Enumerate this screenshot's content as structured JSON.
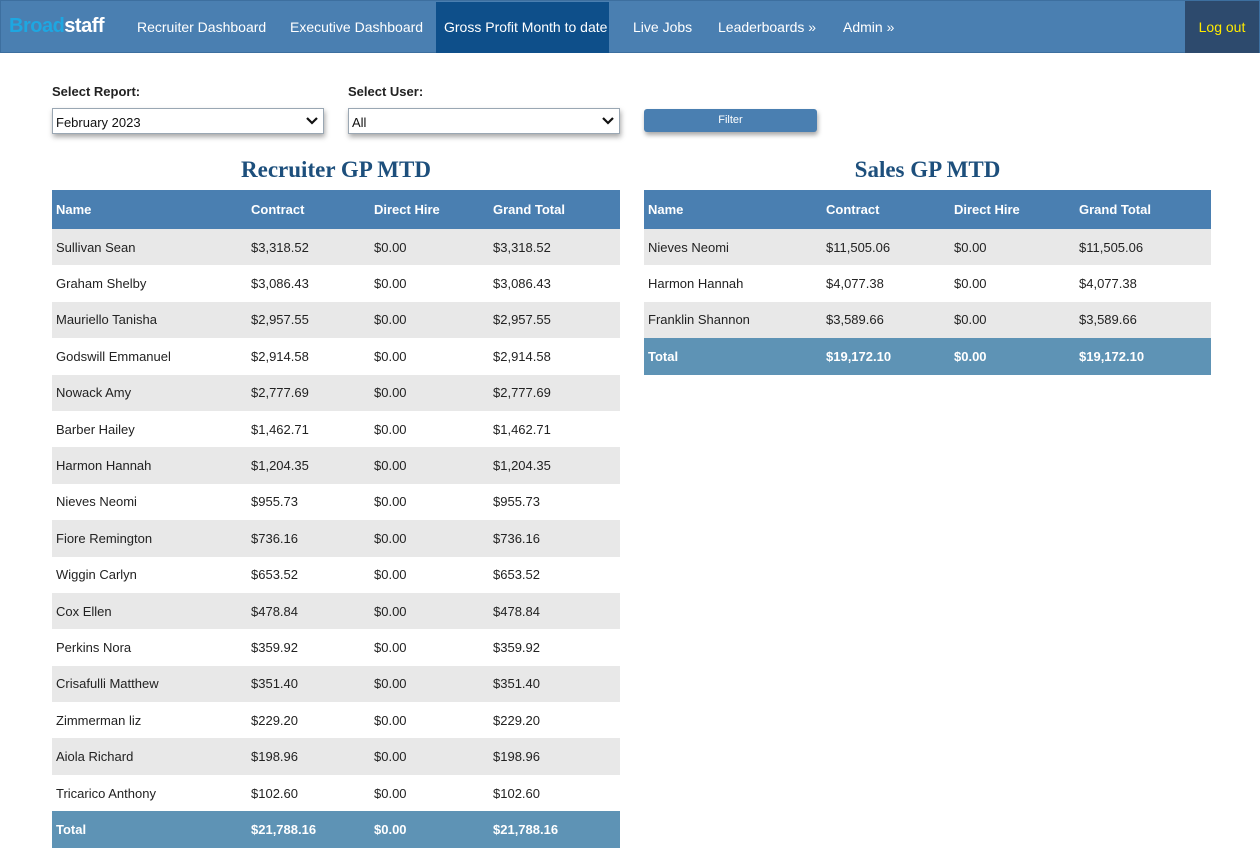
{
  "brand": {
    "part1": "Broad",
    "part2": "staff"
  },
  "nav": {
    "items": [
      {
        "label": "Recruiter Dashboard"
      },
      {
        "label": "Executive Dashboard"
      },
      {
        "label": "Gross Profit Month to date"
      },
      {
        "label": "Live Jobs"
      },
      {
        "label": "Leaderboards »"
      },
      {
        "label": "Admin »"
      }
    ],
    "active_index": 2,
    "logout_label": "Log out"
  },
  "filters": {
    "report_label": "Select Report:",
    "report_value": "February 2023",
    "user_label": "Select User:",
    "user_value": "All",
    "filter_button": "Filter"
  },
  "recruiter": {
    "title": "Recruiter GP MTD",
    "headers": [
      "Name",
      "Contract",
      "Direct Hire",
      "Grand Total"
    ],
    "rows": [
      [
        "Sullivan Sean",
        "$3,318.52",
        "$0.00",
        "$3,318.52"
      ],
      [
        "Graham Shelby",
        "$3,086.43",
        "$0.00",
        "$3,086.43"
      ],
      [
        "Mauriello Tanisha",
        "$2,957.55",
        "$0.00",
        "$2,957.55"
      ],
      [
        "Godswill Emmanuel",
        "$2,914.58",
        "$0.00",
        "$2,914.58"
      ],
      [
        "Nowack Amy",
        "$2,777.69",
        "$0.00",
        "$2,777.69"
      ],
      [
        "Barber Hailey",
        "$1,462.71",
        "$0.00",
        "$1,462.71"
      ],
      [
        "Harmon Hannah",
        "$1,204.35",
        "$0.00",
        "$1,204.35"
      ],
      [
        "Nieves Neomi",
        "$955.73",
        "$0.00",
        "$955.73"
      ],
      [
        "Fiore Remington",
        "$736.16",
        "$0.00",
        "$736.16"
      ],
      [
        "Wiggin Carlyn",
        "$653.52",
        "$0.00",
        "$653.52"
      ],
      [
        "Cox Ellen",
        "$478.84",
        "$0.00",
        "$478.84"
      ],
      [
        "Perkins Nora",
        "$359.92",
        "$0.00",
        "$359.92"
      ],
      [
        "Crisafulli Matthew",
        "$351.40",
        "$0.00",
        "$351.40"
      ],
      [
        "Zimmerman liz",
        "$229.20",
        "$0.00",
        "$229.20"
      ],
      [
        "Aiola Richard",
        "$198.96",
        "$0.00",
        "$198.96"
      ],
      [
        "Tricarico Anthony",
        "$102.60",
        "$0.00",
        "$102.60"
      ]
    ],
    "total": [
      "Total",
      "$21,788.16",
      "$0.00",
      "$21,788.16"
    ]
  },
  "sales": {
    "title": "Sales GP MTD",
    "headers": [
      "Name",
      "Contract",
      "Direct Hire",
      "Grand Total"
    ],
    "rows": [
      [
        "Nieves Neomi",
        "$11,505.06",
        "$0.00",
        "$11,505.06"
      ],
      [
        "Harmon Hannah",
        "$4,077.38",
        "$0.00",
        "$4,077.38"
      ],
      [
        "Franklin Shannon",
        "$3,589.66",
        "$0.00",
        "$3,589.66"
      ]
    ],
    "total": [
      "Total",
      "$19,172.10",
      "$0.00",
      "$19,172.10"
    ]
  },
  "colors": {
    "navbar": "#4a7fb1",
    "nav_active": "#0e4f8a",
    "logout_bg": "#2d4a6d",
    "logout_text": "#ffea00",
    "table_header": "#4a7fb1",
    "table_footer": "#5e93b5",
    "title_text": "#1d4f7c"
  }
}
